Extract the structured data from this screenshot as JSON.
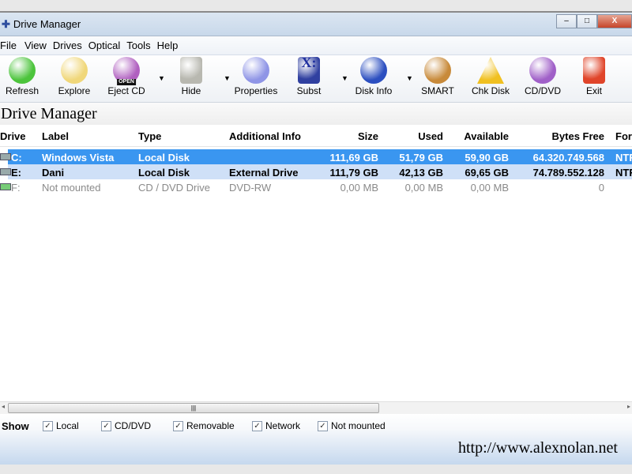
{
  "window": {
    "title": "Drive Manager",
    "min": "–",
    "max": "□",
    "close": "X"
  },
  "menu": [
    "File",
    "View",
    "Drives",
    "Optical",
    "Tools",
    "Help"
  ],
  "toolbar": [
    {
      "label": "Refresh",
      "icon": "refresh-icon",
      "color": "#4cc43c"
    },
    {
      "label": "Explore",
      "icon": "folder-search-icon",
      "color": "#f0d77a"
    },
    {
      "label": "Eject CD",
      "icon": "eject-cd-icon",
      "color": "#b060c0",
      "badge": "OPEN"
    },
    {
      "label": "Hide",
      "icon": "hard-disk-icon",
      "color": "#b8b8b0"
    },
    {
      "label": "Properties",
      "icon": "pie-chart-icon",
      "color": "#8f95e6"
    },
    {
      "label": "Subst",
      "icon": "subst-drive-icon",
      "color": "#3040a0",
      "badge": "X:"
    },
    {
      "label": "Disk Info",
      "icon": "info-icon",
      "color": "#2c4fc0"
    },
    {
      "label": "SMART",
      "icon": "brain-icon",
      "color": "#c88a3a"
    },
    {
      "label": "Chk Disk",
      "icon": "warning-icon",
      "color": "#f0c020"
    },
    {
      "label": "CD/DVD",
      "icon": "cd-dvd-icon",
      "color": "#a060c8"
    },
    {
      "label": "Exit",
      "icon": "power-icon",
      "color": "#e0452a"
    }
  ],
  "heading": "Drive Manager",
  "columns": [
    "Drive",
    "Label",
    "Type",
    "Additional Info",
    "Size",
    "Used",
    "Available",
    "Bytes Free",
    "Format"
  ],
  "rows": [
    {
      "drive": "C:",
      "label": "Windows Vista",
      "type": "Local Disk",
      "info": "",
      "size": "111,69 GB",
      "used": "51,79 GB",
      "avail": "59,90 GB",
      "free": "64.320.749.568",
      "format": "NTFS"
    },
    {
      "drive": "E:",
      "label": "Dani",
      "type": "Local Disk",
      "info": "External Drive",
      "size": "111,79 GB",
      "used": "42,13 GB",
      "avail": "69,65 GB",
      "free": "74.789.552.128",
      "format": "NTFS"
    },
    {
      "drive": "F:",
      "label": "Not mounted",
      "type": "CD / DVD Drive",
      "info": "DVD-RW",
      "size": "0,00 MB",
      "used": "0,00 MB",
      "avail": "0,00 MB",
      "free": "0",
      "format": ""
    }
  ],
  "show": {
    "label": "Show",
    "options": [
      {
        "label": "Local",
        "checked": true
      },
      {
        "label": "CD/DVD",
        "checked": true
      },
      {
        "label": "Removable",
        "checked": true
      },
      {
        "label": "Network",
        "checked": true
      },
      {
        "label": "Not mounted",
        "checked": true
      }
    ]
  },
  "url": "http://www.alexnolan.net"
}
